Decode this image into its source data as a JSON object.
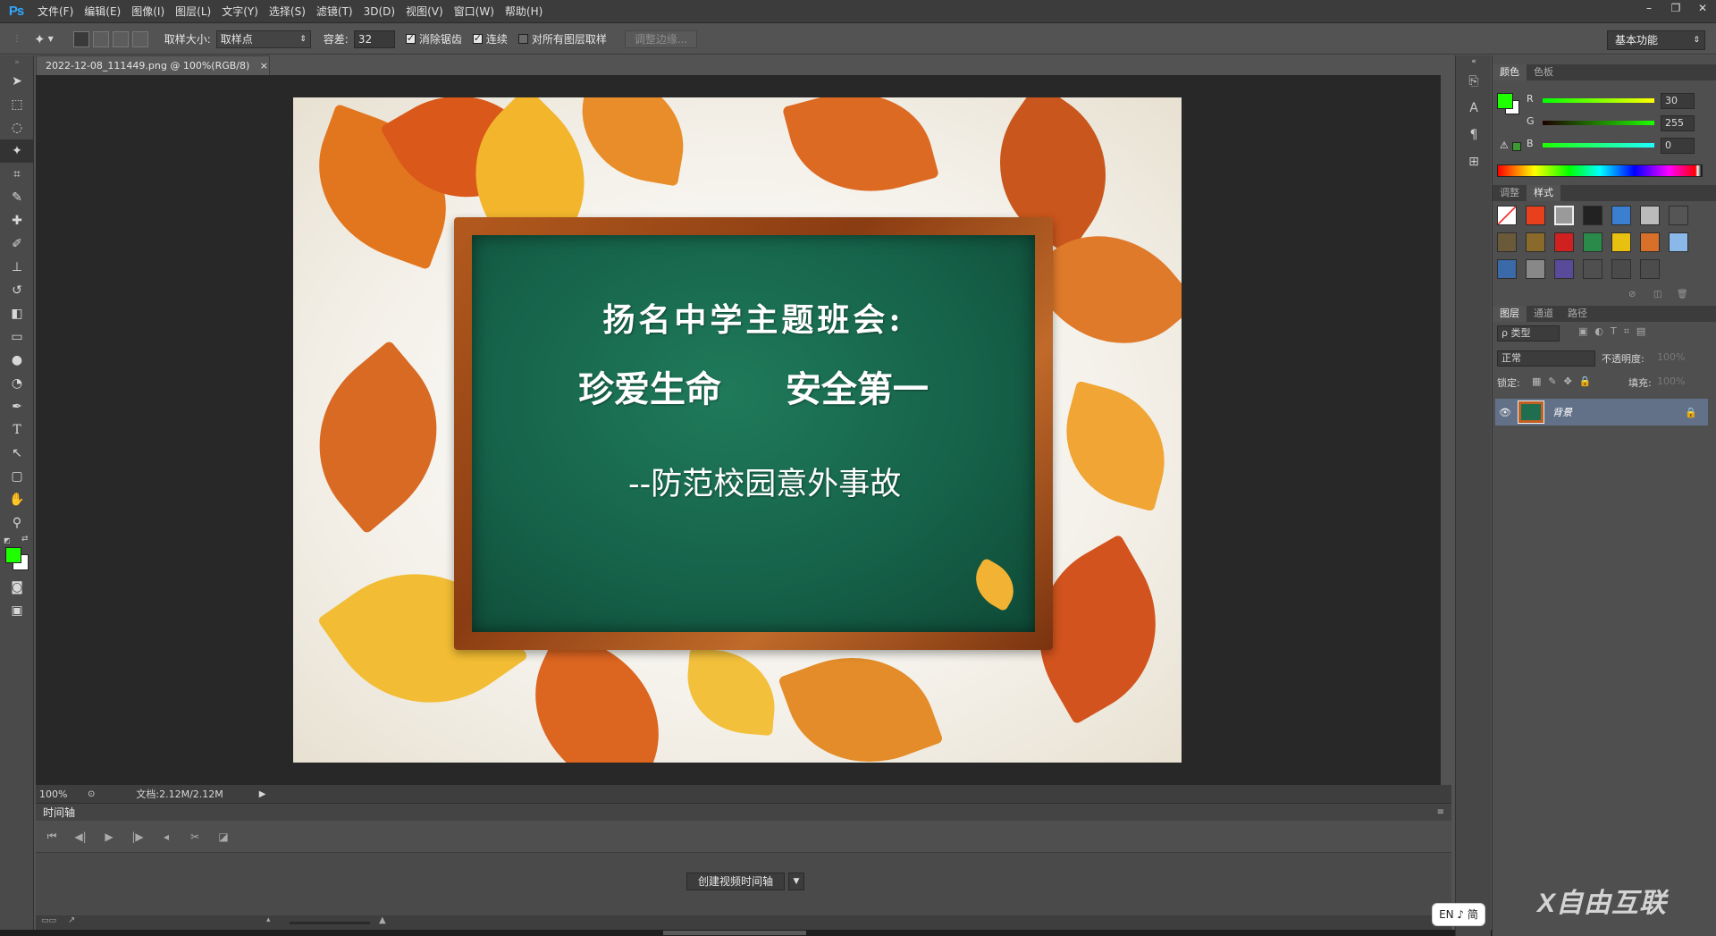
{
  "app": {
    "logo": "Ps"
  },
  "menu": [
    "文件(F)",
    "编辑(E)",
    "图像(I)",
    "图层(L)",
    "文字(Y)",
    "选择(S)",
    "滤镜(T)",
    "3D(D)",
    "视图(V)",
    "窗口(W)",
    "帮助(H)"
  ],
  "window_buttons": [
    "–",
    "❐",
    "✕"
  ],
  "options": {
    "sample_size_label": "取样大小:",
    "sample_size_value": "取样点",
    "tolerance_label": "容差:",
    "tolerance_value": "32",
    "anti_alias_label": "消除锯齿",
    "contiguous_label": "连续",
    "sample_all_layers_label": "对所有图层取样",
    "refine_edge_label": "调整边缘...",
    "workspace": "基本功能"
  },
  "document": {
    "tab_title": "2022-12-08_111449.png @ 100%(RGB/8)",
    "tab_close": "×",
    "board_title": "扬名中学主题班会:",
    "board_line2_a": "珍爱生命",
    "board_line2_b": "安全第一",
    "board_line3": "--防范校园意外事故"
  },
  "status": {
    "zoom": "100%",
    "doc_size": "文档:2.12M/2.12M"
  },
  "timeline": {
    "header": "时间轴",
    "create_button": "创建视频时间轴"
  },
  "color_panel": {
    "tabs": [
      "颜色",
      "色板"
    ],
    "foreground": "#1eff00",
    "background": "#ffffff",
    "r_label": "R",
    "r_value": "30",
    "g_label": "G",
    "g_value": "255",
    "b_label": "B",
    "b_value": "0"
  },
  "styles_panel": {
    "tabs": [
      "调整",
      "样式"
    ]
  },
  "layers_panel": {
    "tabs": [
      "图层",
      "通道",
      "路径"
    ],
    "filter_label": "ρ 类型",
    "blend_mode": "正常",
    "opacity_label": "不透明度:",
    "opacity_value": "100%",
    "lock_label": "锁定:",
    "fill_label": "填充:",
    "fill_value": "100%",
    "layer_name": "背景"
  },
  "ime": "EN ♪ 简",
  "watermark": "X自由互联"
}
